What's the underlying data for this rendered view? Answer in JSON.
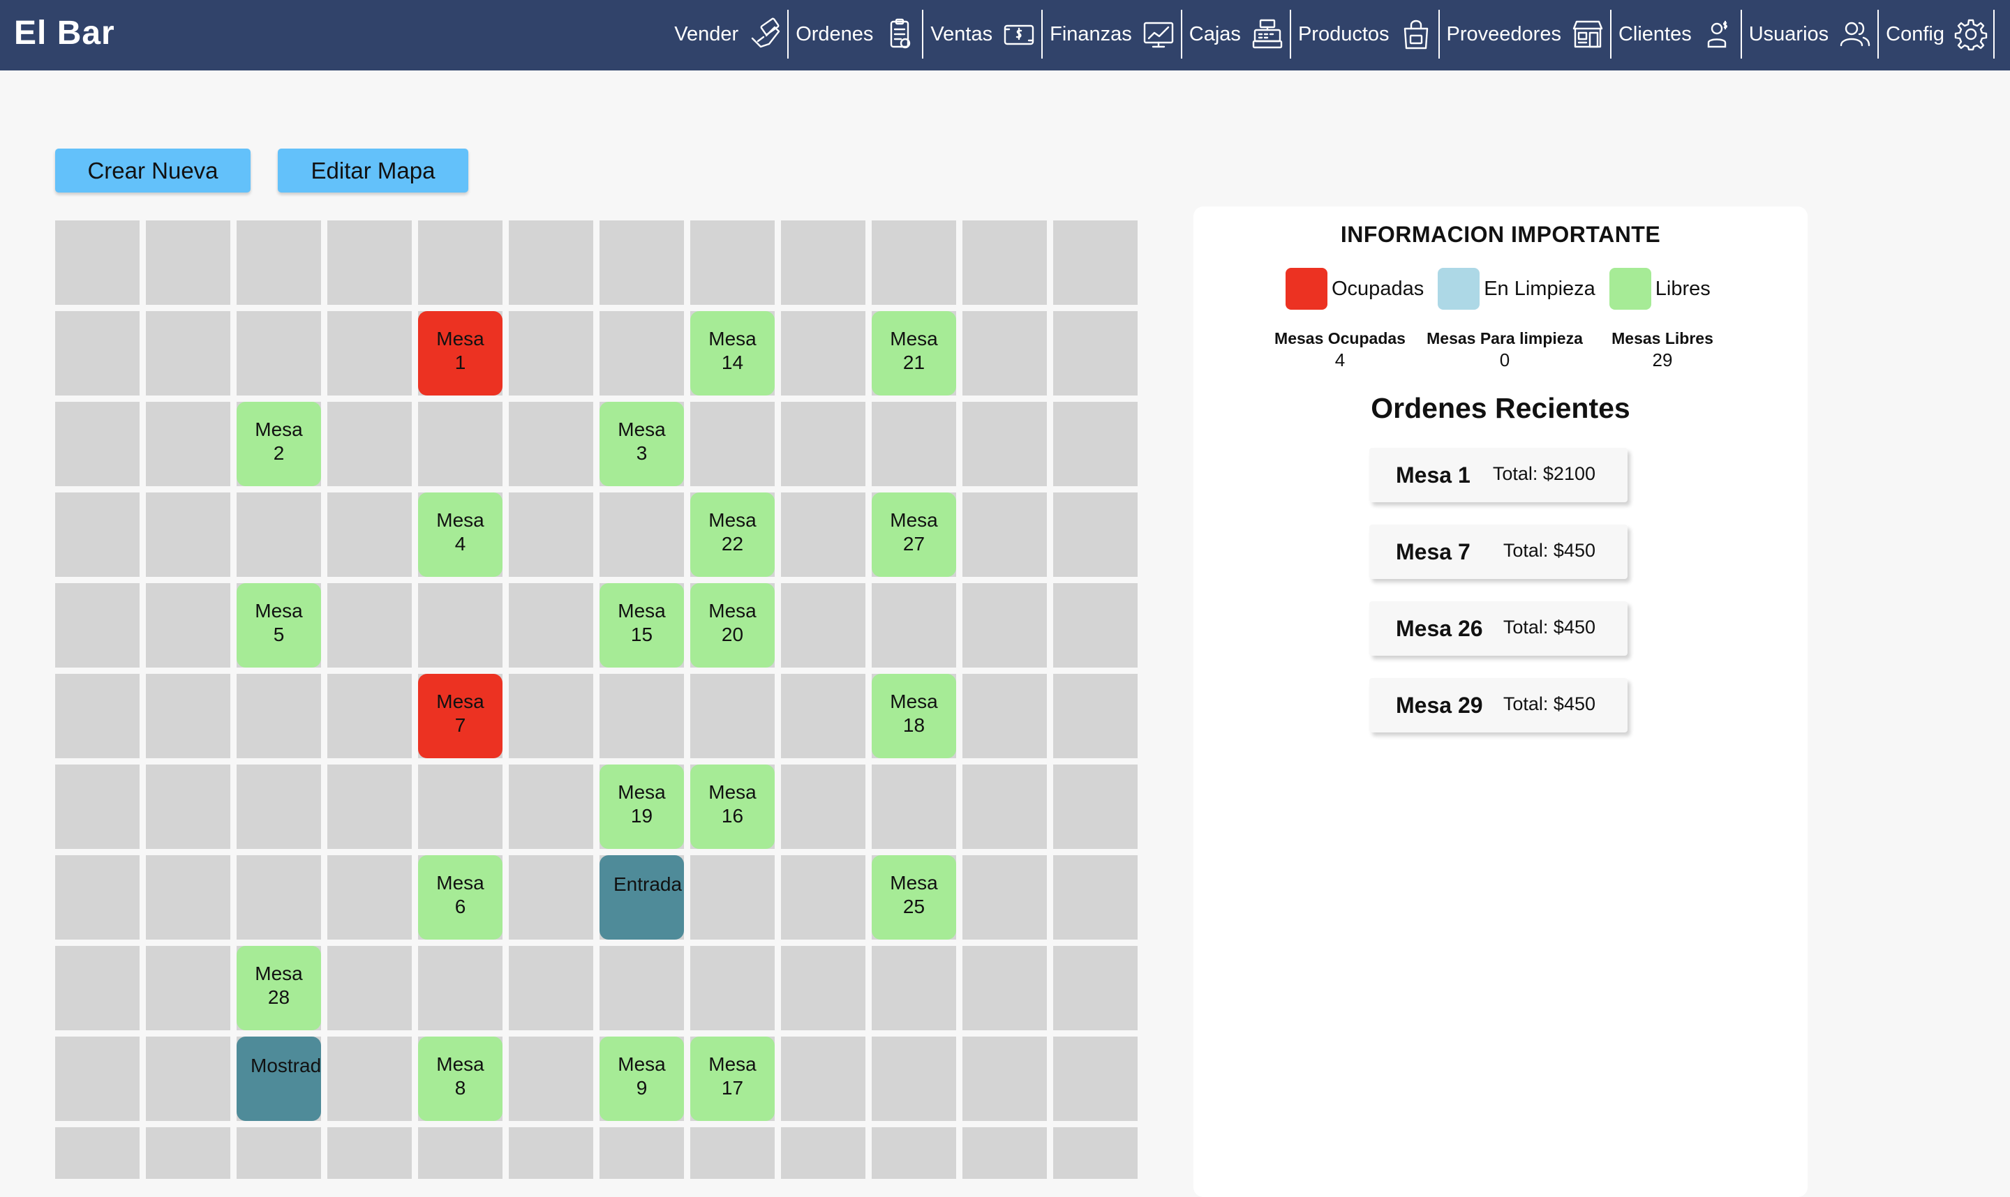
{
  "app": {
    "title": "El Bar"
  },
  "nav": [
    {
      "label": "Vender",
      "icon": "sell-hand-icon"
    },
    {
      "label": "Ordenes",
      "icon": "order-list-icon"
    },
    {
      "label": "Ventas",
      "icon": "money-bill-icon"
    },
    {
      "label": "Finanzas",
      "icon": "finance-chart-icon"
    },
    {
      "label": "Cajas",
      "icon": "cash-register-icon"
    },
    {
      "label": "Productos",
      "icon": "product-bag-icon"
    },
    {
      "label": "Proveedores",
      "icon": "supplier-store-icon"
    },
    {
      "label": "Clientes",
      "icon": "client-user-icon"
    },
    {
      "label": "Usuarios",
      "icon": "users-icon"
    },
    {
      "label": "Config",
      "icon": "gear-icon"
    }
  ],
  "toolbar": {
    "create_label": "Crear Nueva",
    "edit_label": "Editar Mapa"
  },
  "colors": {
    "ocupada": "#ec3222",
    "limpieza": "#add8e6",
    "libre": "#a6eb96",
    "fixture": "#4f8b99",
    "navbar": "#31436a",
    "button": "#63c1fa"
  },
  "map": {
    "columns": 12,
    "visible_rows": 11,
    "tables": [
      {
        "label": "Mesa\n1",
        "row": 1,
        "col": 4,
        "status": "ocupada"
      },
      {
        "label": "Mesa\n14",
        "row": 1,
        "col": 7,
        "status": "libre"
      },
      {
        "label": "Mesa\n21",
        "row": 1,
        "col": 9,
        "status": "libre"
      },
      {
        "label": "Mesa\n2",
        "row": 2,
        "col": 2,
        "status": "libre"
      },
      {
        "label": "Mesa\n3",
        "row": 2,
        "col": 6,
        "status": "libre"
      },
      {
        "label": "Mesa\n4",
        "row": 3,
        "col": 4,
        "status": "libre"
      },
      {
        "label": "Mesa\n22",
        "row": 3,
        "col": 7,
        "status": "libre"
      },
      {
        "label": "Mesa\n27",
        "row": 3,
        "col": 9,
        "status": "libre"
      },
      {
        "label": "Mesa\n5",
        "row": 4,
        "col": 2,
        "status": "libre"
      },
      {
        "label": "Mesa\n15",
        "row": 4,
        "col": 6,
        "status": "libre"
      },
      {
        "label": "Mesa\n20",
        "row": 4,
        "col": 7,
        "status": "libre"
      },
      {
        "label": "Mesa\n7",
        "row": 5,
        "col": 4,
        "status": "ocupada"
      },
      {
        "label": "Mesa\n18",
        "row": 5,
        "col": 9,
        "status": "libre"
      },
      {
        "label": "Mesa\n19",
        "row": 6,
        "col": 6,
        "status": "libre"
      },
      {
        "label": "Mesa\n16",
        "row": 6,
        "col": 7,
        "status": "libre"
      },
      {
        "label": "Mesa\n6",
        "row": 7,
        "col": 4,
        "status": "libre"
      },
      {
        "label": "Entrada",
        "row": 7,
        "col": 6,
        "status": "fixture"
      },
      {
        "label": "Mesa\n25",
        "row": 7,
        "col": 9,
        "status": "libre"
      },
      {
        "label": "Mesa\n28",
        "row": 8,
        "col": 2,
        "status": "libre"
      },
      {
        "label": "Mostrador",
        "row": 9,
        "col": 2,
        "status": "fixture"
      },
      {
        "label": "Mesa\n8",
        "row": 9,
        "col": 4,
        "status": "libre"
      },
      {
        "label": "Mesa\n9",
        "row": 9,
        "col": 6,
        "status": "libre"
      },
      {
        "label": "Mesa\n17",
        "row": 9,
        "col": 7,
        "status": "libre"
      }
    ]
  },
  "info": {
    "title": "INFORMACION IMPORTANTE",
    "legend": [
      {
        "label": "Ocupadas",
        "color": "#ec3222"
      },
      {
        "label": "En Limpieza",
        "color": "#add8e6"
      },
      {
        "label": "Libres",
        "color": "#a6eb96"
      }
    ],
    "counts": [
      {
        "label": "Mesas Ocupadas",
        "value": "4"
      },
      {
        "label": "Mesas Para limpieza",
        "value": "0"
      },
      {
        "label": "Mesas Libres",
        "value": "29"
      }
    ],
    "orders_title": "Ordenes Recientes",
    "orders": [
      {
        "table": "Mesa 1",
        "total": "Total: $2100"
      },
      {
        "table": "Mesa 7",
        "total": "Total: $450"
      },
      {
        "table": "Mesa 26",
        "total": "Total: $450"
      },
      {
        "table": "Mesa 29",
        "total": "Total: $450"
      }
    ]
  }
}
